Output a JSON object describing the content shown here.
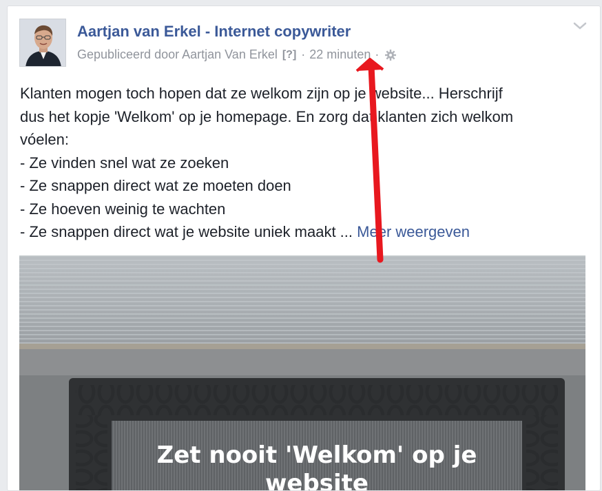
{
  "post": {
    "page_name": "Aartjan van Erkel - Internet copywriter",
    "published_by": "Gepubliceerd door Aartjan Van Erkel",
    "help_marker": "[?]",
    "separator": "·",
    "time": "22 minuten",
    "icons": {
      "menu": "chevron-down-icon",
      "audience": "gear-icon",
      "avatar": "profile-photo"
    },
    "text_lines": [
      "Klanten mogen toch hopen dat ze welkom zijn op je website... Herschrijf",
      "dus het kopje 'Welkom' op je homepage. En zorg dat klanten zich welkom",
      "vóelen:",
      "- Ze vinden snel wat ze zoeken",
      "- Ze snappen direct wat ze moeten doen",
      "- Ze hoeven weinig te wachten"
    ],
    "last_line": "- Ze snappen direct wat je website uniek maakt ...",
    "see_more": "Meer weergeven",
    "image_caption_line1": "Zet nooit 'Welkom' op je",
    "image_caption_line2": "website"
  },
  "colors": {
    "link": "#3b5998",
    "meta": "#90949c",
    "text": "#1d2129",
    "annotation_arrow": "#e8181f"
  }
}
